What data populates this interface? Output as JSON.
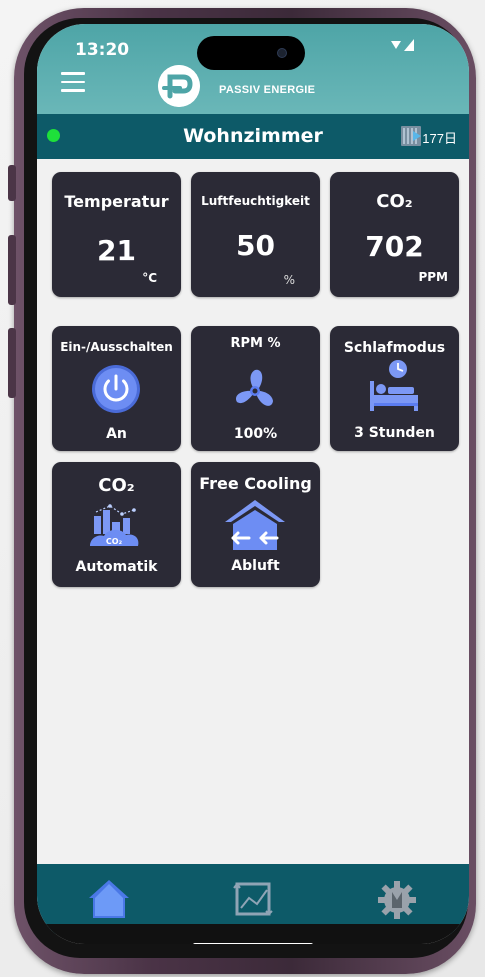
{
  "status": {
    "time": "13:20"
  },
  "header": {
    "brand": "PASSIV ENERGIE"
  },
  "room": {
    "title": "Wohnzimmer",
    "filter_days": "177日",
    "status_color": "#1ee03a"
  },
  "tiles": {
    "temperature": {
      "title": "Temperatur",
      "value": "21",
      "unit": "°C"
    },
    "humidity": {
      "title": "Luftfeuchtigkeit",
      "value": "50",
      "unit": "%"
    },
    "co2": {
      "title": "CO₂",
      "value": "702",
      "unit": "PPM"
    },
    "power": {
      "title": "Ein-/Ausschalten",
      "state": "An",
      "icon": "power-icon"
    },
    "rpm": {
      "title": "RPM %",
      "value": "100%",
      "icon": "fan-icon"
    },
    "sleep": {
      "title": "Schlafmodus",
      "value": "3 Stunden",
      "icon": "bed-icon"
    },
    "co2mode": {
      "title": "CO₂",
      "badge": "CO₂",
      "state": "Automatik",
      "icon": "co2-city-icon"
    },
    "freecooling": {
      "title": "Free Cooling",
      "state": "Abluft",
      "icon": "house-arrows-icon"
    }
  },
  "nav": {
    "items": [
      "home-icon",
      "chart-icon",
      "settings-icon"
    ]
  },
  "colors": {
    "header": "#5aaeaf",
    "bar": "#0d5a68",
    "tile": "#2b2a36",
    "accent": "#5b7cf0"
  }
}
